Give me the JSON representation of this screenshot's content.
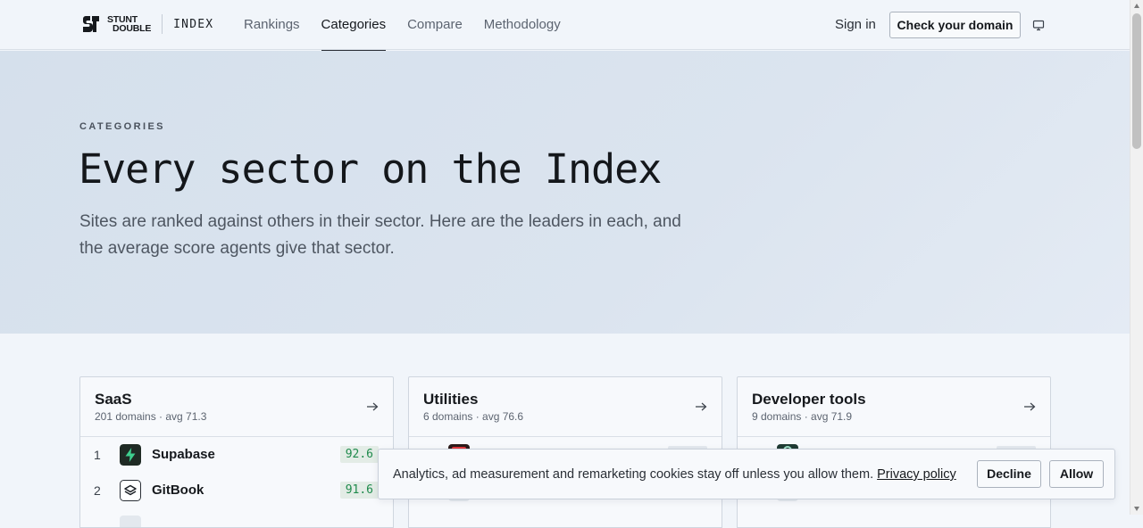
{
  "header": {
    "logo_line1": "STUNT",
    "logo_line2": "DOUBLE",
    "logo_product": "INDEX",
    "nav": [
      {
        "label": "Rankings",
        "active": false
      },
      {
        "label": "Categories",
        "active": true
      },
      {
        "label": "Compare",
        "active": false
      },
      {
        "label": "Methodology",
        "active": false
      }
    ],
    "sign_in": "Sign in",
    "cta": "Check your domain",
    "theme_icon": "monitor-icon"
  },
  "hero": {
    "eyebrow": "CATEGORIES",
    "title": "Every sector on the Index",
    "subtitle": "Sites are ranked against others in their sector. Here are the leaders in each, and the average score agents give that sector."
  },
  "cards": [
    {
      "title": "SaaS",
      "meta": "201 domains · avg 71.3",
      "rows": [
        {
          "rank": "1",
          "name": "Supabase",
          "score": "92.6",
          "icon": "supabase-icon",
          "color": "#1f2a24"
        },
        {
          "rank": "2",
          "name": "GitBook",
          "score": "91.6",
          "icon": "gitbook-icon",
          "color": "#ffffff"
        }
      ]
    },
    {
      "title": "Utilities",
      "meta": "6 domains · avg 76.6",
      "rows": []
    },
    {
      "title": "Developer tools",
      "meta": "9 domains · avg 71.9",
      "rows": []
    }
  ],
  "cookie": {
    "text": "Analytics, ad measurement and remarketing cookies stay off unless you allow them.",
    "link": "Privacy policy",
    "decline": "Decline",
    "allow": "Allow"
  },
  "colors": {
    "accent_score_bg": "#e3ece6",
    "accent_score_text": "#1f8a4c",
    "hero_bg": "#d8e2ee",
    "page_bg": "#f1f5fa"
  }
}
